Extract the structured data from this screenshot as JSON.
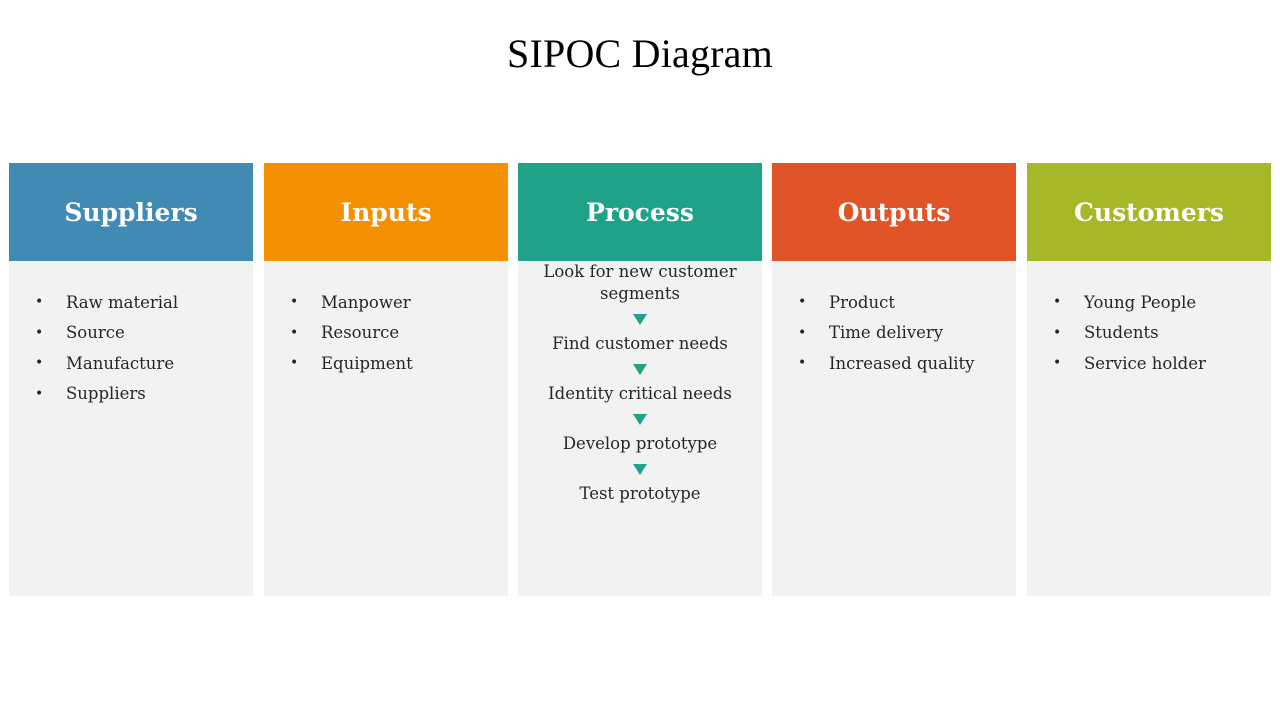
{
  "title": "SIPOC Diagram",
  "columns": [
    {
      "heading": "Suppliers",
      "color": "#418ab3",
      "type": "bullets",
      "items": [
        "Raw material",
        "Source",
        "Manufacture",
        "Suppliers"
      ]
    },
    {
      "heading": "Inputs",
      "color": "#f59100",
      "type": "bullets",
      "items": [
        "Manpower",
        "Resource",
        "Equipment"
      ]
    },
    {
      "heading": "Process",
      "color": "#1fa287",
      "type": "flow",
      "items": [
        "Look for new customer segments",
        "Find customer needs",
        "Identity critical needs",
        "Develop prototype",
        "Test prototype"
      ]
    },
    {
      "heading": "Outputs",
      "color": "#e05428",
      "type": "bullets",
      "items": [
        "Product",
        "Time delivery",
        "Increased quality"
      ]
    },
    {
      "heading": "Customers",
      "color": "#a6b727",
      "type": "bullets",
      "items": [
        "Young People",
        "Students",
        "Service holder"
      ]
    }
  ],
  "icons": {
    "bullet": "•",
    "flow_arrow": "down-triangle-icon"
  }
}
